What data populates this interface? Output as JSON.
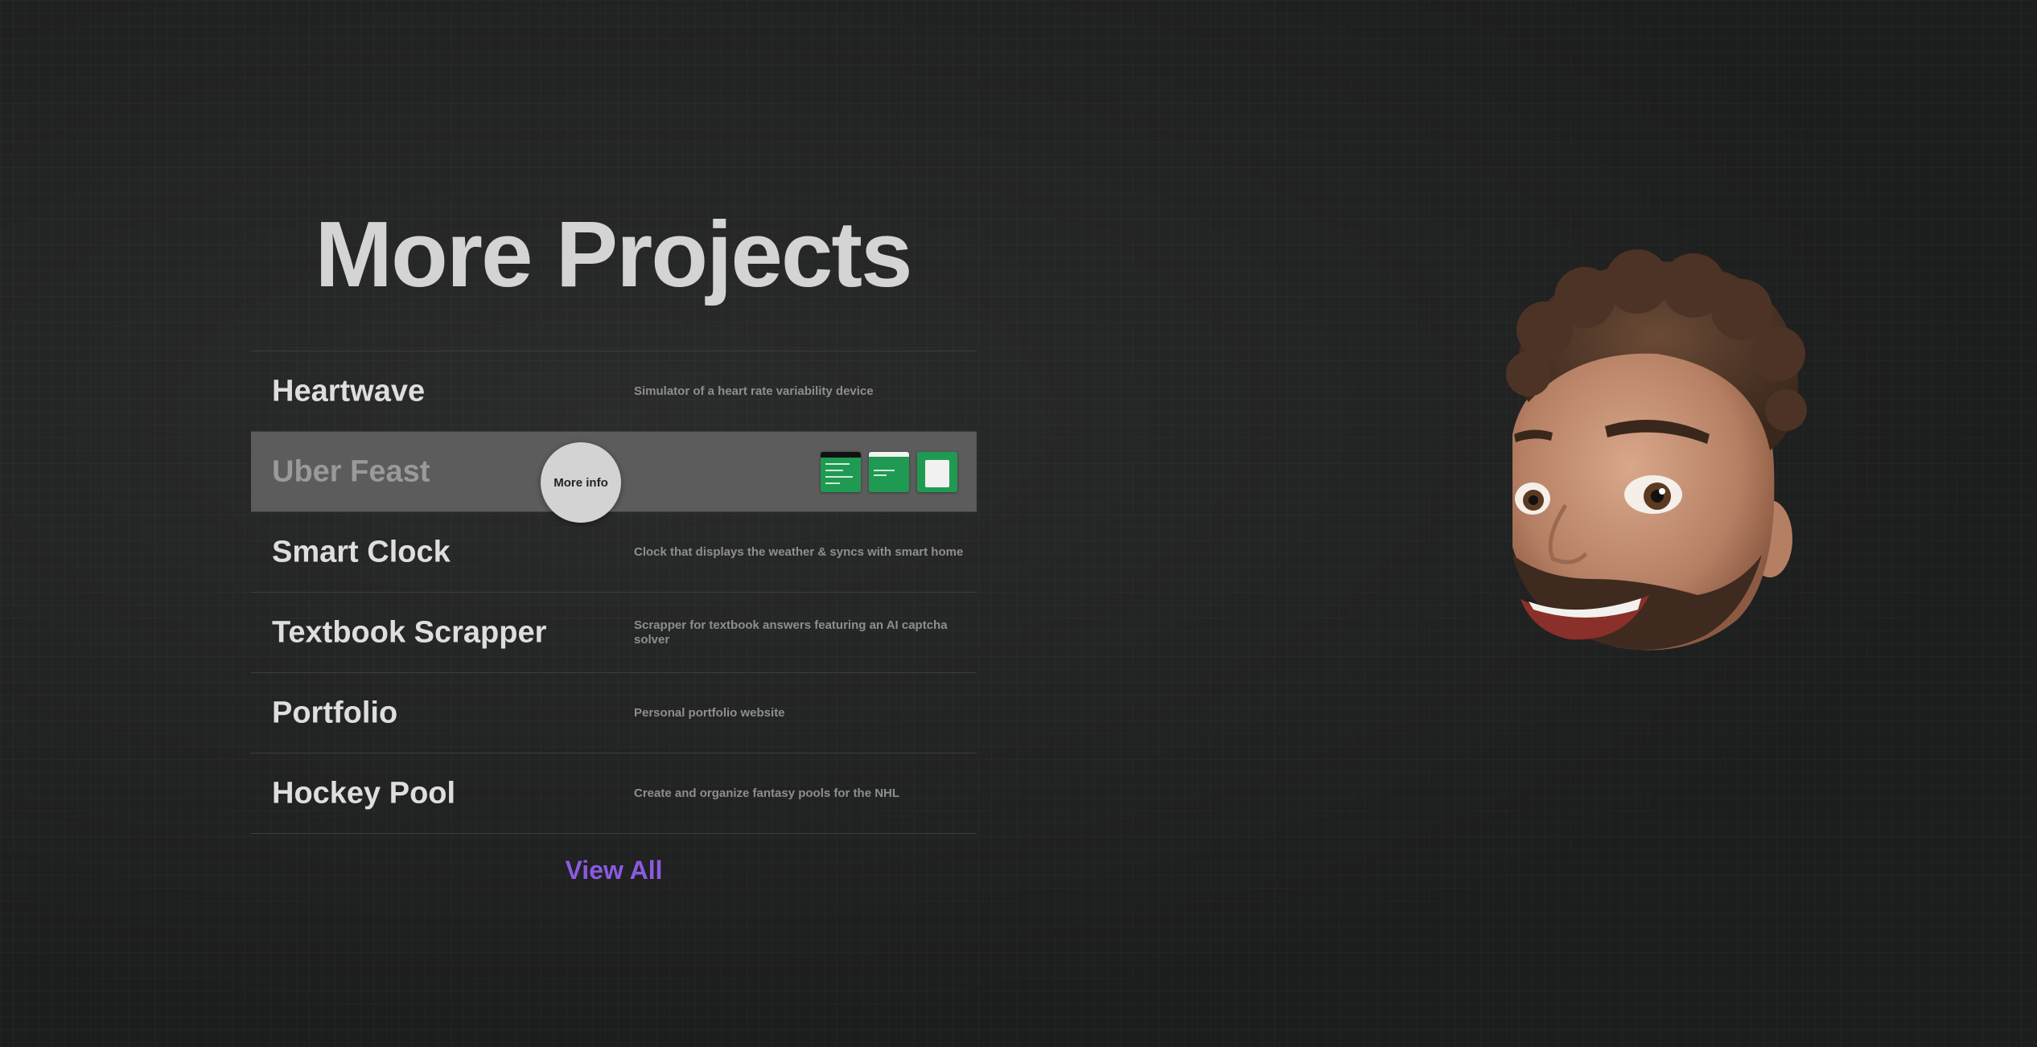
{
  "section": {
    "title": "More Projects"
  },
  "projects": [
    {
      "name": "Heartwave",
      "description": "Simulator of a heart rate variability device"
    },
    {
      "name": "Uber Feast",
      "description": ""
    },
    {
      "name": "Smart Clock",
      "description": "Clock that displays the weather & syncs with smart home"
    },
    {
      "name": "Textbook Scrapper",
      "description": "Scrapper for textbook answers featuring an AI captcha solver"
    },
    {
      "name": "Portfolio",
      "description": "Personal portfolio website"
    },
    {
      "name": "Hockey Pool",
      "description": "Create and organize fantasy pools for the NHL"
    }
  ],
  "hover_cursor": {
    "label": "More info"
  },
  "actions": {
    "view_all": "View All"
  },
  "colors": {
    "accent": "#8a5be0",
    "thumbnail_green": "#1f9a52",
    "active_row": "#5c5c5c"
  },
  "avatar": {
    "icon": "memoji-avatar-icon"
  }
}
